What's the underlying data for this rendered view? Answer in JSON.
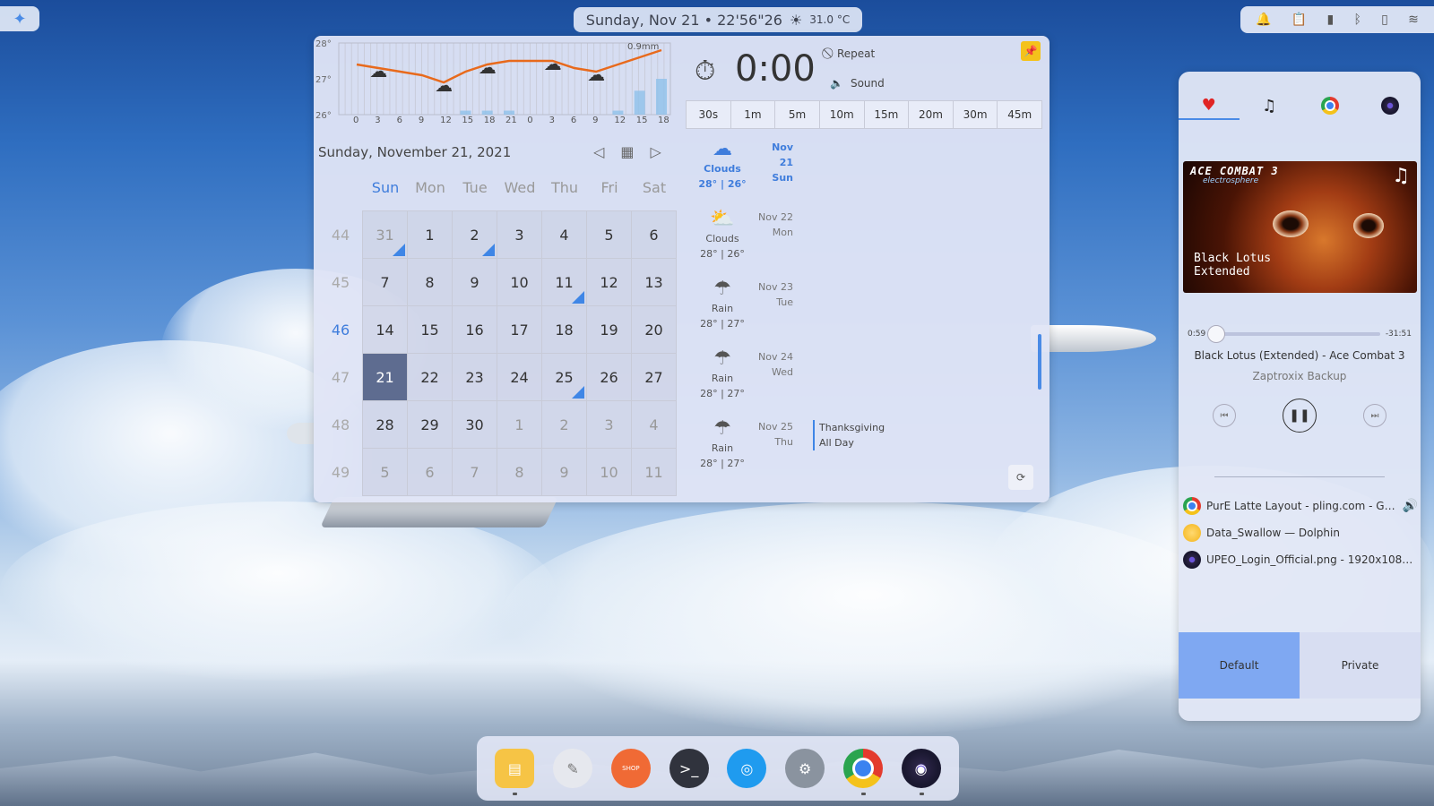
{
  "topbar": {
    "datetime": "Sunday, Nov 21 • 22'56\"26",
    "weather_icon": "sun-icon",
    "temperature": "31.0 °C",
    "tray_icons": [
      "bell-icon",
      "clipboard-icon",
      "battery-icon",
      "bluetooth-icon",
      "battery-small-icon",
      "wifi-icon"
    ]
  },
  "weather_graph": {
    "y_labels": [
      "28°",
      "27°",
      "26°"
    ],
    "x_labels": [
      "0",
      "3",
      "6",
      "9",
      "12",
      "15",
      "18",
      "21",
      "0",
      "3",
      "6",
      "9",
      "12",
      "15",
      "18"
    ],
    "precip_label": "0.9mm",
    "temps": [
      27.4,
      27.3,
      27.2,
      27.1,
      26.9,
      27.2,
      27.4,
      27.5,
      27.5,
      27.5,
      27.3,
      27.2,
      27.4,
      27.6,
      27.8
    ],
    "precip": [
      0,
      0,
      0,
      0,
      0,
      0.1,
      0.1,
      0.1,
      0,
      0,
      0,
      0,
      0.1,
      0.6,
      0.9
    ]
  },
  "calendar": {
    "title": "Sunday, November 21, 2021",
    "days": [
      "Sun",
      "Mon",
      "Tue",
      "Wed",
      "Thu",
      "Fri",
      "Sat"
    ],
    "weeks": [
      {
        "num": "44",
        "days": [
          "31",
          "1",
          "2",
          "3",
          "4",
          "5",
          "6"
        ]
      },
      {
        "num": "45",
        "days": [
          "7",
          "8",
          "9",
          "10",
          "11",
          "12",
          "13"
        ]
      },
      {
        "num": "46",
        "days": [
          "14",
          "15",
          "16",
          "17",
          "18",
          "19",
          "20"
        ]
      },
      {
        "num": "47",
        "days": [
          "21",
          "22",
          "23",
          "24",
          "25",
          "26",
          "27"
        ]
      },
      {
        "num": "48",
        "days": [
          "28",
          "29",
          "30",
          "1",
          "2",
          "3",
          "4"
        ]
      },
      {
        "num": "49",
        "days": [
          "5",
          "6",
          "7",
          "8",
          "9",
          "10",
          "11"
        ]
      }
    ],
    "current_week": "46",
    "selected": "21",
    "event_days": [
      "31",
      "2",
      "11",
      "25"
    ]
  },
  "timer": {
    "value": "0:00",
    "repeat_label": "Repeat",
    "sound_label": "Sound",
    "presets": [
      "30s",
      "1m",
      "5m",
      "10m",
      "15m",
      "20m",
      "30m",
      "45m"
    ]
  },
  "forecast": [
    {
      "cond": "Clouds",
      "temps": "28° | 26°",
      "date": "Nov 21",
      "day": "Sun",
      "icon": "cloud-icon"
    },
    {
      "cond": "Clouds",
      "temps": "28° | 26°",
      "date": "Nov 22",
      "day": "Mon",
      "icon": "partly-cloudy-icon"
    },
    {
      "cond": "Rain",
      "temps": "28° | 27°",
      "date": "Nov 23",
      "day": "Tue",
      "icon": "rain-icon"
    },
    {
      "cond": "Rain",
      "temps": "28° | 27°",
      "date": "Nov 24",
      "day": "Wed",
      "icon": "rain-icon"
    },
    {
      "cond": "Rain",
      "temps": "28° | 27°",
      "date": "Nov 25",
      "day": "Thu",
      "icon": "rain-icon"
    }
  ],
  "event": {
    "title": "Thanksgiving",
    "when": "All Day"
  },
  "media": {
    "album_game": "ACE COMBAT 3",
    "album_sub": "electrosphere",
    "album_title": "Black Lotus Extended",
    "elapsed": "0:59",
    "remaining": "-31:51",
    "progress": 0.03,
    "song": "Black Lotus (Extended) - Ace Combat 3",
    "artist": "Zaptroxix Backup",
    "players": [
      {
        "title": "PurE Latte Layout - pling.com - Goo...",
        "icon": "chrome-icon"
      },
      {
        "title": "Data_Swallow — Dolphin",
        "icon": "dolphin-icon"
      },
      {
        "title": "UPEO_Login_Official.png - 1920x1080 - ...",
        "icon": "disc-icon"
      }
    ],
    "profile_default": "Default",
    "profile_private": "Private"
  },
  "dock": {
    "apps": [
      "folder-icon",
      "notes-icon",
      "shop-icon",
      "terminal-icon",
      "browser-icon",
      "settings-icon",
      "chrome-icon",
      "obs-icon"
    ],
    "shop_label": "SHOP",
    "terminal_label": ">_"
  }
}
